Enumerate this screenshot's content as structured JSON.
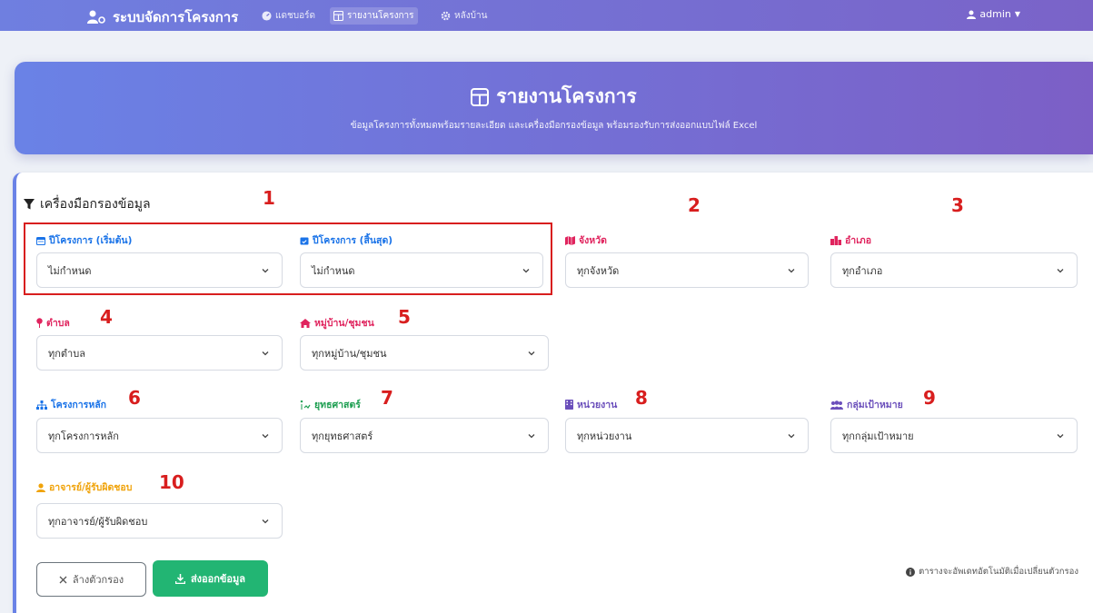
{
  "navbar": {
    "brand": "ระบบจัดการโครงการ",
    "items": [
      {
        "label": "แดชบอร์ด",
        "icon": "gauge-icon"
      },
      {
        "label": "รายงานโครงการ",
        "icon": "table-icon",
        "active": true
      },
      {
        "label": "หลังบ้าน",
        "icon": "gear-icon"
      }
    ],
    "user": "admin"
  },
  "hero": {
    "title": "รายงานโครงการ",
    "subtitle": "ข้อมูลโครงการทั้งหมดพร้อมรายละเอียด และเครื่องมือกรองข้อมูล พร้อมรองรับการส่งออกแบบไฟล์ Excel"
  },
  "filters": {
    "title": "เครื่องมือกรองข้อมูล",
    "fields": [
      {
        "label": "ปีโครงการ (เริ่มต้น)",
        "value": "ไม่กำหนด",
        "color": "#1a73e8",
        "icon": "calendar-icon"
      },
      {
        "label": "ปีโครงการ (สิ้นสุด)",
        "value": "ไม่กำหนด",
        "color": "#1a73e8",
        "icon": "calendar-check-icon"
      },
      {
        "label": "จังหวัด",
        "value": "ทุกจังหวัด",
        "color": "#e0245e",
        "icon": "map-icon"
      },
      {
        "label": "อำเภอ",
        "value": "ทุกอำเภอ",
        "color": "#e0245e",
        "icon": "city-icon"
      },
      {
        "label": "ตำบล",
        "value": "ทุกตำบล",
        "color": "#e0245e",
        "icon": "pin-icon"
      },
      {
        "label": "หมู่บ้าน/ชุมชน",
        "value": "ทุกหมู่บ้าน/ชุมชน",
        "color": "#e0245e",
        "icon": "home-icon"
      },
      {
        "label": "โครงการหลัก",
        "value": "ทุกโครงการหลัก",
        "color": "#1a73e8",
        "icon": "sitemap-icon"
      },
      {
        "label": "ยุทธศาสตร์",
        "value": "ทุกยุทธศาสตร์",
        "color": "#1c9e50",
        "icon": "strategy-icon"
      },
      {
        "label": "หน่วยงาน",
        "value": "ทุกหน่วยงาน",
        "color": "#6b4fbb",
        "icon": "building-icon"
      },
      {
        "label": "กลุ่มเป้าหมาย",
        "value": "ทุกกลุ่มเป้าหมาย",
        "color": "#6b4fbb",
        "icon": "users-icon"
      },
      {
        "label": "อาจารย์/ผู้รับผิดชอบ",
        "value": "ทุกอาจารย์/ผู้รับผิดชอบ",
        "color": "#f0a30a",
        "icon": "user-icon"
      }
    ]
  },
  "annotations": [
    "1",
    "2",
    "3",
    "4",
    "5",
    "6",
    "7",
    "8",
    "9",
    "10"
  ],
  "actions": {
    "clear_label": "ล้างตัวกรอง",
    "export_label": "ส่งออกข้อมูล",
    "note": "ตารางจะอัพเดทอัตโนมัติเมื่อเปลี่ยนตัวกรอง"
  },
  "colors": {
    "accent": "#6a82e6",
    "export": "#22b573",
    "annotation": "#d81e1e"
  }
}
